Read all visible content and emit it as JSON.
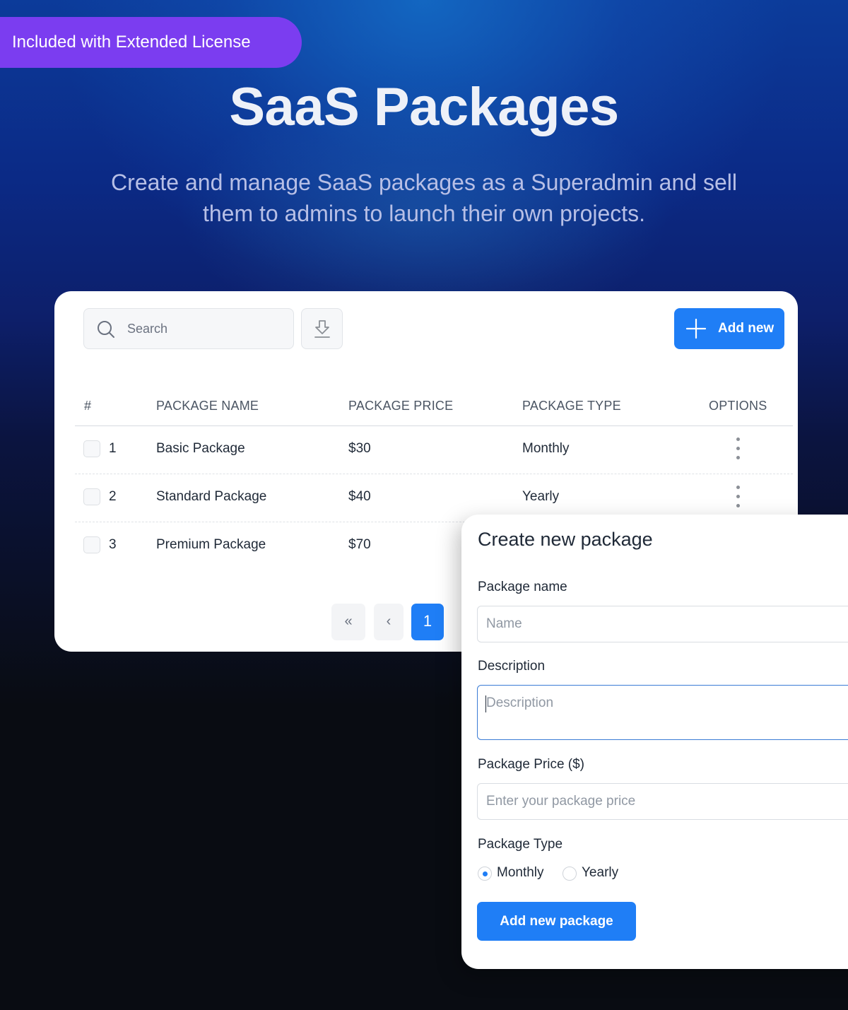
{
  "badge": "Included with Extended License",
  "hero": {
    "title": "SaaS Packages",
    "subtitle_line1": "Create and manage SaaS packages as a Superadmin and sell",
    "subtitle_line2": "them to admins to launch their own projects."
  },
  "toolbar": {
    "search_placeholder": "Search",
    "add_label": "Add new"
  },
  "table": {
    "headers": [
      "#",
      "PACKAGE NAME",
      "PACKAGE PRICE",
      "PACKAGE TYPE",
      "OPTIONS"
    ],
    "rows": [
      {
        "index": "1",
        "name": "Basic Package",
        "price": "$30",
        "type": "Monthly"
      },
      {
        "index": "2",
        "name": "Standard Package",
        "price": "$40",
        "type": "Yearly"
      },
      {
        "index": "3",
        "name": "Premium Package",
        "price": "$70",
        "type": ""
      }
    ]
  },
  "pagination": {
    "first": "«",
    "prev": "‹",
    "current": "1"
  },
  "modal": {
    "title": "Create new package",
    "name_label": "Package name",
    "name_placeholder": "Name",
    "description_label": "Description",
    "description_placeholder": "Description",
    "price_label": "Package Price ($)",
    "price_placeholder": "Enter your package price",
    "type_label": "Package Type",
    "type_options": [
      "Monthly",
      "Yearly"
    ],
    "type_selected": "Monthly",
    "submit_label": "Add new package"
  },
  "colors": {
    "accent": "#1f7ef6",
    "badge": "#7b3df0",
    "background": "#090c12"
  }
}
